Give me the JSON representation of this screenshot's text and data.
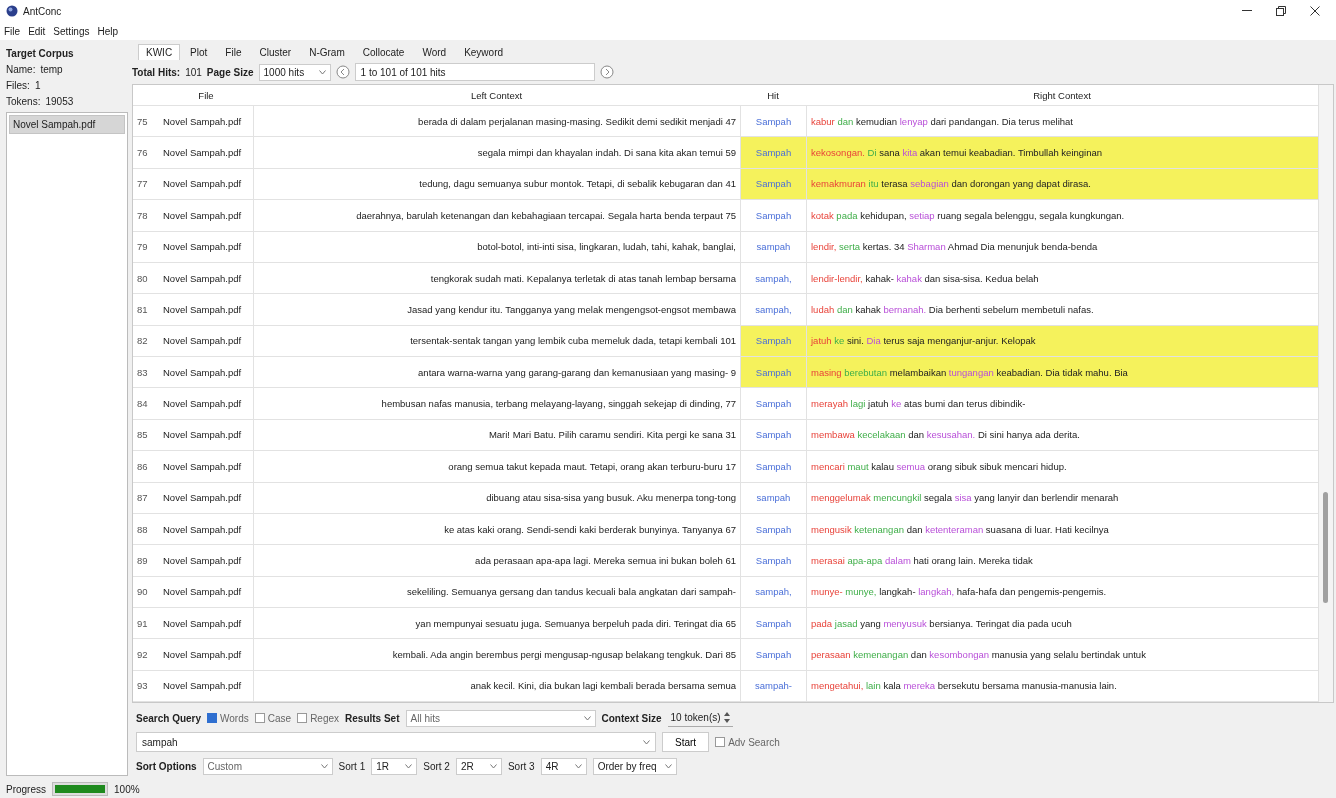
{
  "window": {
    "title": "AntConc"
  },
  "menu": [
    "File",
    "Edit",
    "Settings",
    "Help"
  ],
  "sidebar": {
    "heading": "Target Corpus",
    "fields": [
      {
        "label": "Name:",
        "value": "temp"
      },
      {
        "label": "Files:",
        "value": "1"
      },
      {
        "label": "Tokens:",
        "value": "19053"
      }
    ],
    "files": [
      {
        "name": "Novel Sampah.pdf",
        "selected": true
      }
    ]
  },
  "tabs": [
    {
      "label": "KWIC",
      "selected": true
    },
    {
      "label": "Plot",
      "selected": false
    },
    {
      "label": "File",
      "selected": false
    },
    {
      "label": "Cluster",
      "selected": false
    },
    {
      "label": "N-Gram",
      "selected": false
    },
    {
      "label": "Collocate",
      "selected": false
    },
    {
      "label": "Word",
      "selected": false
    },
    {
      "label": "Keyword",
      "selected": false
    }
  ],
  "hits_bar": {
    "total_label": "Total Hits:",
    "total": "101",
    "page_size_label": "Page Size",
    "page_size": "1000 hits",
    "range": "1 to 101 of 101 hits"
  },
  "table": {
    "columns": [
      "File",
      "Left Context",
      "Hit",
      "Right Context"
    ],
    "rows": [
      {
        "n": "75",
        "file": "Novel Sampah.pdf",
        "left": "berada di dalam perjalanan masing-masing. Sedikit demi sedikit menjadi 47",
        "hit": "Sampah",
        "highlighted": false,
        "right": [
          {
            "text": "kabur",
            "kind": "first"
          },
          {
            "text": "dan",
            "kind": "second"
          },
          {
            "text": "kemudian",
            "kind": "plain"
          },
          {
            "text": "lenyap",
            "kind": "fourth"
          },
          {
            "text": "dari pandangan. Dia terus melihat",
            "kind": "plain"
          }
        ]
      },
      {
        "n": "76",
        "file": "Novel Sampah.pdf",
        "left": "segala mimpi dan khayalan indah. Di sana kita akan temui 59",
        "hit": "Sampah",
        "highlighted": true,
        "right": [
          {
            "text": "kekosongan.",
            "kind": "first"
          },
          {
            "text": "Di",
            "kind": "second"
          },
          {
            "text": "sana",
            "kind": "plain"
          },
          {
            "text": "kita",
            "kind": "fourth"
          },
          {
            "text": "akan temui keabadian. Timbullah keinginan",
            "kind": "plain"
          }
        ]
      },
      {
        "n": "77",
        "file": "Novel Sampah.pdf",
        "left": "tedung, dagu semuanya subur montok. Tetapi, di sebalik kebugaran dan 41",
        "hit": "Sampah",
        "highlighted": true,
        "right": [
          {
            "text": "kemakmuran",
            "kind": "first"
          },
          {
            "text": "itu",
            "kind": "second"
          },
          {
            "text": "terasa",
            "kind": "plain"
          },
          {
            "text": "sebagian",
            "kind": "fourth"
          },
          {
            "text": "dan dorongan yang dapat dirasa.",
            "kind": "plain"
          }
        ]
      },
      {
        "n": "78",
        "file": "Novel Sampah.pdf",
        "left": "daerahnya, barulah ketenangan dan kebahagiaan tercapai. Segala harta benda terpaut 75",
        "hit": "Sampah",
        "highlighted": false,
        "right": [
          {
            "text": "kotak",
            "kind": "first"
          },
          {
            "text": "pada",
            "kind": "second"
          },
          {
            "text": "kehidupan,",
            "kind": "plain"
          },
          {
            "text": "setiap",
            "kind": "fourth"
          },
          {
            "text": "ruang segala belenggu, segala kungkungan.",
            "kind": "plain"
          }
        ]
      },
      {
        "n": "79",
        "file": "Novel Sampah.pdf",
        "left": "botol-botol, inti-inti sisa, lingkaran, ludah, tahi, kahak, banglai,",
        "hit": "sampah",
        "highlighted": false,
        "right": [
          {
            "text": "lendir,",
            "kind": "first"
          },
          {
            "text": "serta",
            "kind": "second"
          },
          {
            "text": "kertas. 34",
            "kind": "plain"
          },
          {
            "text": "Sharman",
            "kind": "fourth"
          },
          {
            "text": "Ahmad Dia menunjuk benda-benda",
            "kind": "plain"
          }
        ]
      },
      {
        "n": "80",
        "file": "Novel Sampah.pdf",
        "left": "tengkorak sudah mati. Kepalanya terletak di atas tanah lembap bersama",
        "hit": "sampah,",
        "highlighted": false,
        "right": [
          {
            "text": "lendir-lendir,",
            "kind": "first"
          },
          {
            "text": "kahak-",
            "kind": "plain"
          },
          {
            "text": "kahak",
            "kind": "fourth"
          },
          {
            "text": "dan sisa-sisa. Kedua belah",
            "kind": "plain"
          }
        ]
      },
      {
        "n": "81",
        "file": "Novel Sampah.pdf",
        "left": "Jasad yang kendur itu. Tangganya yang melak mengengsot-engsot membawa",
        "hit": "sampah,",
        "highlighted": false,
        "right": [
          {
            "text": "ludah",
            "kind": "first"
          },
          {
            "text": "dan",
            "kind": "second"
          },
          {
            "text": "kahak",
            "kind": "plain"
          },
          {
            "text": "bernanah.",
            "kind": "fourth"
          },
          {
            "text": "Dia berhenti sebelum membetuli nafas.",
            "kind": "plain"
          }
        ]
      },
      {
        "n": "82",
        "file": "Novel Sampah.pdf",
        "left": "tersentak-sentak tangan yang lembik cuba memeluk dada, tetapi kembali 101",
        "hit": "Sampah",
        "highlighted": true,
        "right": [
          {
            "text": "jatuh",
            "kind": "first"
          },
          {
            "text": "ke",
            "kind": "second"
          },
          {
            "text": "sini.",
            "kind": "plain"
          },
          {
            "text": "Dia",
            "kind": "fourth"
          },
          {
            "text": "terus saja menganjur-anjur. Kelopak",
            "kind": "plain"
          }
        ]
      },
      {
        "n": "83",
        "file": "Novel Sampah.pdf",
        "left": "antara warna-warna yang garang-garang dan kemanusiaan yang masing- 9",
        "hit": "Sampah",
        "highlighted": true,
        "right": [
          {
            "text": "masing",
            "kind": "first"
          },
          {
            "text": "berebutan",
            "kind": "second"
          },
          {
            "text": "melambaikan",
            "kind": "plain"
          },
          {
            "text": "tungangan",
            "kind": "fourth"
          },
          {
            "text": "keabadian. Dia tidak mahu. Bia",
            "kind": "plain"
          }
        ]
      },
      {
        "n": "84",
        "file": "Novel Sampah.pdf",
        "left": "hembusan nafas manusia, terbang melayang-layang, singgah sekejap di dinding, 77",
        "hit": "Sampah",
        "highlighted": false,
        "right": [
          {
            "text": "merayah",
            "kind": "first"
          },
          {
            "text": "lagi",
            "kind": "second"
          },
          {
            "text": "jatuh",
            "kind": "plain"
          },
          {
            "text": "ke",
            "kind": "fourth"
          },
          {
            "text": "atas bumi dan terus dibindik-",
            "kind": "plain"
          }
        ]
      },
      {
        "n": "85",
        "file": "Novel Sampah.pdf",
        "left": "Mari! Mari Batu. Pilih caramu sendiri. Kita pergi ke sana 31",
        "hit": "Sampah",
        "highlighted": false,
        "right": [
          {
            "text": "membawa",
            "kind": "first"
          },
          {
            "text": "kecelakaan",
            "kind": "second"
          },
          {
            "text": "dan",
            "kind": "plain"
          },
          {
            "text": "kesusahan.",
            "kind": "fourth"
          },
          {
            "text": "Di sini hanya ada derita.",
            "kind": "plain"
          }
        ]
      },
      {
        "n": "86",
        "file": "Novel Sampah.pdf",
        "left": "orang semua takut kepada maut. Tetapi, orang akan terburu-buru 17",
        "hit": "Sampah",
        "highlighted": false,
        "right": [
          {
            "text": "mencari",
            "kind": "first"
          },
          {
            "text": "maut",
            "kind": "second"
          },
          {
            "text": "kalau",
            "kind": "plain"
          },
          {
            "text": "semua",
            "kind": "fourth"
          },
          {
            "text": "orang sibuk sibuk mencari hidup.",
            "kind": "plain"
          }
        ]
      },
      {
        "n": "87",
        "file": "Novel Sampah.pdf",
        "left": "dibuang atau sisa-sisa yang busuk. Aku menerpa tong-tong",
        "hit": "sampah",
        "highlighted": false,
        "right": [
          {
            "text": "menggelumak",
            "kind": "first"
          },
          {
            "text": "mencungkil",
            "kind": "second"
          },
          {
            "text": "segala",
            "kind": "plain"
          },
          {
            "text": "sisa",
            "kind": "fourth"
          },
          {
            "text": "yang lanyir dan berlendir menarah",
            "kind": "plain"
          }
        ]
      },
      {
        "n": "88",
        "file": "Novel Sampah.pdf",
        "left": "ke atas kaki orang. Sendi-sendi kaki berderak bunyinya. Tanyanya 67",
        "hit": "Sampah",
        "highlighted": false,
        "right": [
          {
            "text": "mengusik",
            "kind": "first"
          },
          {
            "text": "ketenangan",
            "kind": "second"
          },
          {
            "text": "dan",
            "kind": "plain"
          },
          {
            "text": "ketenteraman",
            "kind": "fourth"
          },
          {
            "text": "suasana di luar. Hati kecilnya",
            "kind": "plain"
          }
        ]
      },
      {
        "n": "89",
        "file": "Novel Sampah.pdf",
        "left": "ada perasaan apa-apa lagi. Mereka semua ini bukan boleh 61",
        "hit": "Sampah",
        "highlighted": false,
        "right": [
          {
            "text": "merasai",
            "kind": "first"
          },
          {
            "text": "apa-apa",
            "kind": "second"
          },
          {
            "text": "dalam",
            "kind": "fourth"
          },
          {
            "text": "hati orang lain. Mereka tidak",
            "kind": "plain"
          }
        ]
      },
      {
        "n": "90",
        "file": "Novel Sampah.pdf",
        "left": "sekeliling. Semuanya gersang dan tandus kecuali bala angkatan dari sampah-",
        "hit": "sampah,",
        "highlighted": false,
        "right": [
          {
            "text": "munye-",
            "kind": "first"
          },
          {
            "text": "munye,",
            "kind": "second"
          },
          {
            "text": "langkah-",
            "kind": "plain"
          },
          {
            "text": "langkah,",
            "kind": "fourth"
          },
          {
            "text": "hafa-hafa dan pengemis-pengemis.",
            "kind": "plain"
          }
        ]
      },
      {
        "n": "91",
        "file": "Novel Sampah.pdf",
        "left": "yan mempunyai sesuatu juga. Semuanya berpeluh pada diri. Teringat dia 65",
        "hit": "Sampah",
        "highlighted": false,
        "right": [
          {
            "text": "pada",
            "kind": "first"
          },
          {
            "text": "jasad",
            "kind": "second"
          },
          {
            "text": "yang",
            "kind": "plain"
          },
          {
            "text": "menyusuk",
            "kind": "fourth"
          },
          {
            "text": "bersianya. Teringat dia pada ucuh",
            "kind": "plain"
          }
        ]
      },
      {
        "n": "92",
        "file": "Novel Sampah.pdf",
        "left": "kembali. Ada angin berembus pergi mengusap-ngusap belakang tengkuk. Dari 85",
        "hit": "Sampah",
        "highlighted": false,
        "right": [
          {
            "text": "perasaan",
            "kind": "first"
          },
          {
            "text": "kemenangan",
            "kind": "second"
          },
          {
            "text": "dan",
            "kind": "plain"
          },
          {
            "text": "kesombongan",
            "kind": "fourth"
          },
          {
            "text": "manusia yang selalu bertindak untuk",
            "kind": "plain"
          }
        ]
      },
      {
        "n": "93",
        "file": "Novel Sampah.pdf",
        "left": "anak kecil. Kini, dia bukan lagi kembali berada bersama semua",
        "hit": "sampah-",
        "highlighted": false,
        "right": [
          {
            "text": "mengetahui,",
            "kind": "first"
          },
          {
            "text": "lain",
            "kind": "second"
          },
          {
            "text": "kala",
            "kind": "plain"
          },
          {
            "text": "mereka",
            "kind": "fourth"
          },
          {
            "text": "bersekutu bersama manusia-manusia lain.",
            "kind": "plain"
          }
        ]
      }
    ]
  },
  "search": {
    "label": "Search Query",
    "options": [
      {
        "label": "Words",
        "checked": true
      },
      {
        "label": "Case",
        "checked": false
      },
      {
        "label": "Regex",
        "checked": false
      }
    ],
    "results_label": "Results Set",
    "results": "All hits",
    "context_label": "Context Size",
    "context": "10 token(s)",
    "query": "sampah",
    "start": "Start",
    "adv": {
      "label": "Adv Search",
      "checked": false
    }
  },
  "sort": {
    "label": "Sort Options",
    "preset": "Custom",
    "levels": [
      {
        "label": "Sort 1",
        "value": "1R"
      },
      {
        "label": "Sort 2",
        "value": "2R"
      },
      {
        "label": "Sort 3",
        "value": "4R"
      }
    ],
    "order": "Order by freq"
  },
  "status": {
    "label": "Progress",
    "level": 1,
    "reading": "100%"
  }
}
